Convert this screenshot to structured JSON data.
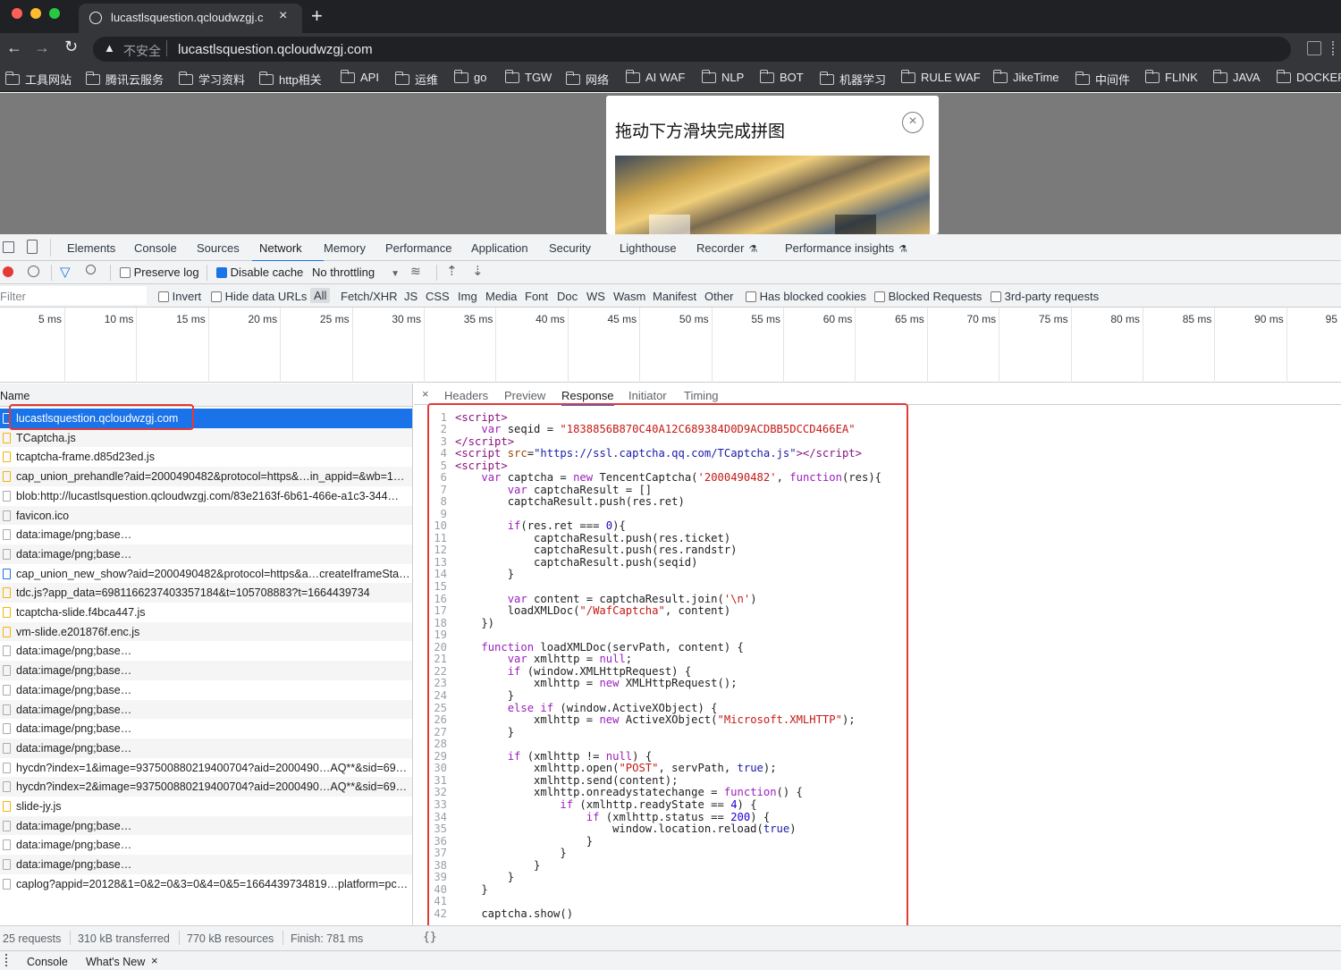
{
  "browser": {
    "tab_title": "lucastlsquestion.qcloudwzgj.c",
    "url_insecure_label": "不安全",
    "url": "lucastlsquestion.qcloudwzgj.com",
    "bookmarks": [
      "工具网站",
      "腾讯云服务",
      "学习资料",
      "http相关",
      "API",
      "运维",
      "go",
      "TGW",
      "网络",
      "AI WAF",
      "NLP",
      "BOT",
      "机器学习",
      "RULE WAF",
      "JikeTime",
      "中间件",
      "FLINK",
      "JAVA",
      "DOCKER"
    ]
  },
  "captcha": {
    "title": "拖动下方滑块完成拼图"
  },
  "devtools": {
    "tabs": [
      "Elements",
      "Console",
      "Sources",
      "Network",
      "Memory",
      "Performance",
      "Application",
      "Security",
      "Lighthouse",
      "Recorder",
      "Performance insights"
    ],
    "active_tab": "Network",
    "toolbar": {
      "preserve_log": "Preserve log",
      "disable_cache": "Disable cache",
      "throttling": "No throttling"
    },
    "filter": {
      "placeholder": "Filter",
      "invert": "Invert",
      "hide_data_urls": "Hide data URLs",
      "types": [
        "All",
        "Fetch/XHR",
        "JS",
        "CSS",
        "Img",
        "Media",
        "Font",
        "Doc",
        "WS",
        "Wasm",
        "Manifest",
        "Other"
      ],
      "has_blocked_cookies": "Has blocked cookies",
      "blocked_requests": "Blocked Requests",
      "third_party": "3rd-party requests"
    },
    "timeline_ticks": [
      "5 ms",
      "10 ms",
      "15 ms",
      "20 ms",
      "25 ms",
      "30 ms",
      "35 ms",
      "40 ms",
      "45 ms",
      "50 ms",
      "55 ms",
      "60 ms",
      "65 ms",
      "70 ms",
      "75 ms",
      "80 ms",
      "85 ms",
      "90 ms",
      "95"
    ],
    "name_header": "Name",
    "requests": [
      "lucastlsquestion.qcloudwzgj.com",
      "TCaptcha.js",
      "tcaptcha-frame.d85d23ed.js",
      "cap_union_prehandle?aid=2000490482&protocol=https&…in_appid=&wb=1…",
      "blob:http://lucastlsquestion.qcloudwzgj.com/83e2163f-6b61-466e-a1c3-344…",
      "favicon.ico",
      "data:image/png;base…",
      "data:image/png;base…",
      "cap_union_new_show?aid=2000490482&protocol=https&a…createIframeSta…",
      "tdc.js?app_data=6981166237403357184&t=105708883?t=1664439734",
      "tcaptcha-slide.f4bca447.js",
      "vm-slide.e201876f.enc.js",
      "data:image/png;base…",
      "data:image/png;base…",
      "data:image/png;base…",
      "data:image/png;base…",
      "data:image/png;base…",
      "data:image/png;base…",
      "hycdn?index=1&image=937500880219400704?aid=2000490…AQ**&sid=69…",
      "hycdn?index=2&image=937500880219400704?aid=2000490…AQ**&sid=69…",
      "slide-jy.js",
      "data:image/png;base…",
      "data:image/png;base…",
      "data:image/png;base…",
      "caplog?appid=20128&1=0&2=0&3=0&4=0&5=1664439734819…platform=pc…"
    ],
    "detail_tabs": [
      "Headers",
      "Preview",
      "Response",
      "Initiator",
      "Timing"
    ],
    "active_detail_tab": "Response",
    "status": {
      "requests": "25 requests",
      "transferred": "310 kB transferred",
      "resources": "770 kB resources",
      "finish": "Finish: 781 ms"
    },
    "drawer_tabs": [
      "Console",
      "What's New"
    ]
  },
  "colors": {
    "accent": "#1a73e8",
    "highlight": "#e53935",
    "selected_row": "#1a73e8"
  }
}
